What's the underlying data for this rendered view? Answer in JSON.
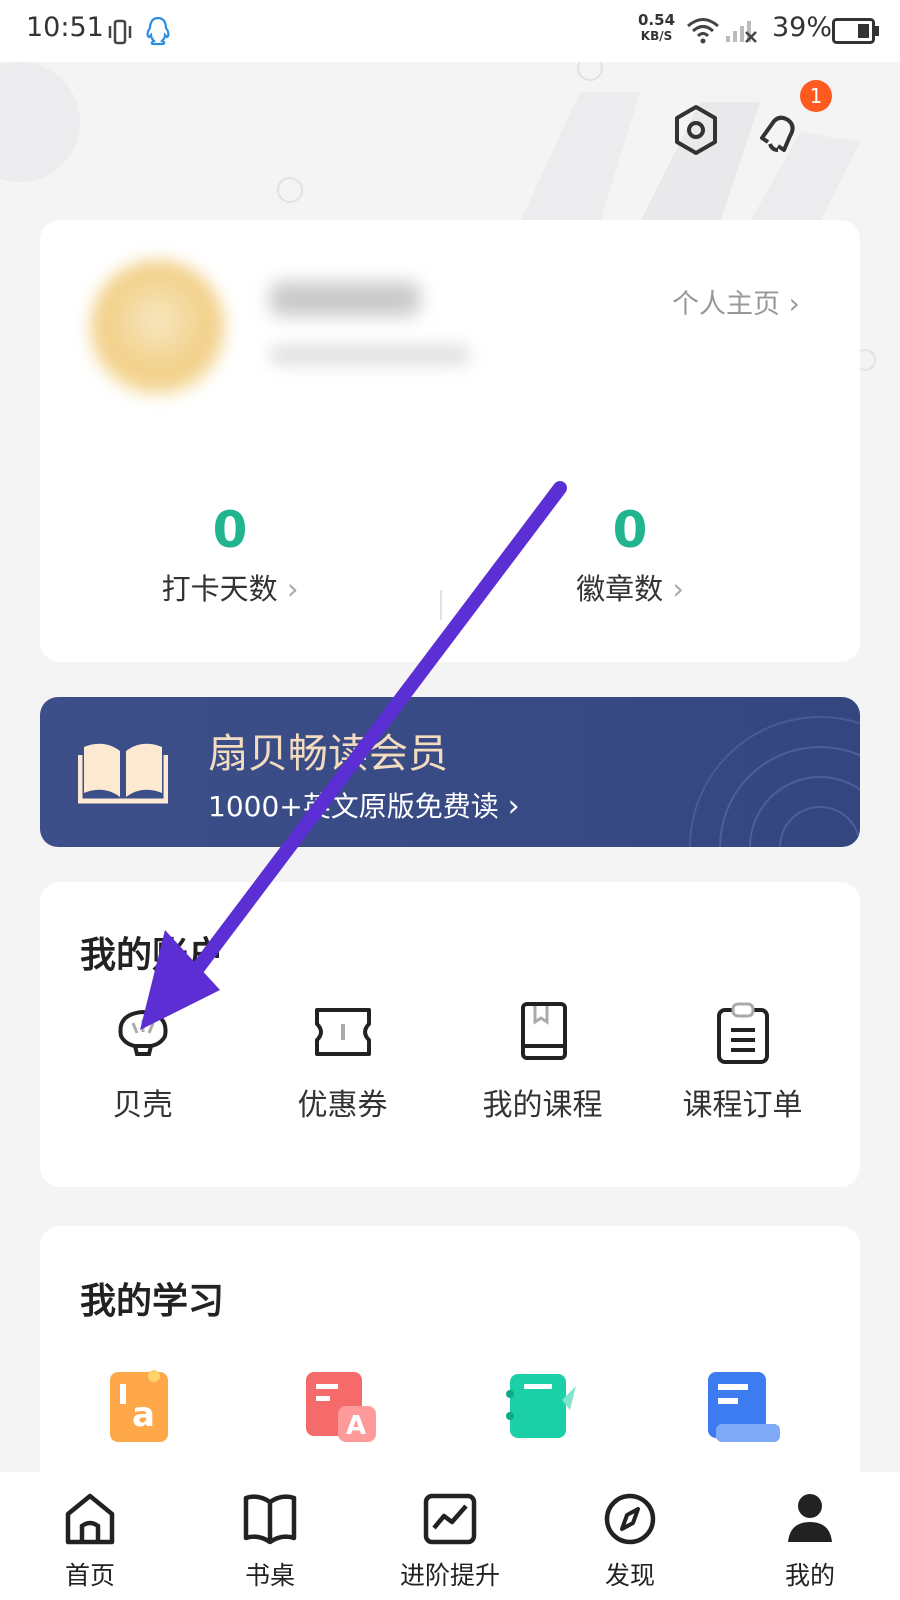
{
  "status_bar": {
    "time": "10:51",
    "net_speed": "0.54",
    "net_unit": "KB/S",
    "battery": "39%"
  },
  "header": {
    "notification_count": "1"
  },
  "profile": {
    "homepage_link": "个人主页"
  },
  "stats": [
    {
      "value": "0",
      "label": "打卡天数"
    },
    {
      "value": "0",
      "label": "徽章数"
    }
  ],
  "vip": {
    "title": "扇贝畅读会员",
    "subtitle": "1000+英文原版免费读"
  },
  "account": {
    "title": "我的账户",
    "items": [
      {
        "label": "贝壳",
        "icon": "shell-icon"
      },
      {
        "label": "优惠券",
        "icon": "coupon-icon"
      },
      {
        "label": "我的课程",
        "icon": "course-book-icon"
      },
      {
        "label": "课程订单",
        "icon": "order-clipboard-icon"
      }
    ]
  },
  "study": {
    "title": "我的学习",
    "items": [
      {
        "icon": "vocabulary-icon",
        "color": "#ff9a3c"
      },
      {
        "icon": "word-card-icon",
        "color": "#f46a6a"
      },
      {
        "icon": "notebook-icon",
        "color": "#19c9a8"
      },
      {
        "icon": "document-icon",
        "color": "#3d7cf0"
      }
    ]
  },
  "bottom_nav": [
    {
      "label": "首页",
      "icon": "home-icon"
    },
    {
      "label": "书桌",
      "icon": "book-icon"
    },
    {
      "label": "进阶提升",
      "icon": "chart-icon"
    },
    {
      "label": "发现",
      "icon": "compass-icon"
    },
    {
      "label": "我的",
      "icon": "profile-icon"
    }
  ],
  "colors": {
    "accent_green": "#20b58e",
    "vip_bg": "#3a4c86",
    "arrow": "#5b2fd3",
    "badge": "#ff5a1f"
  }
}
